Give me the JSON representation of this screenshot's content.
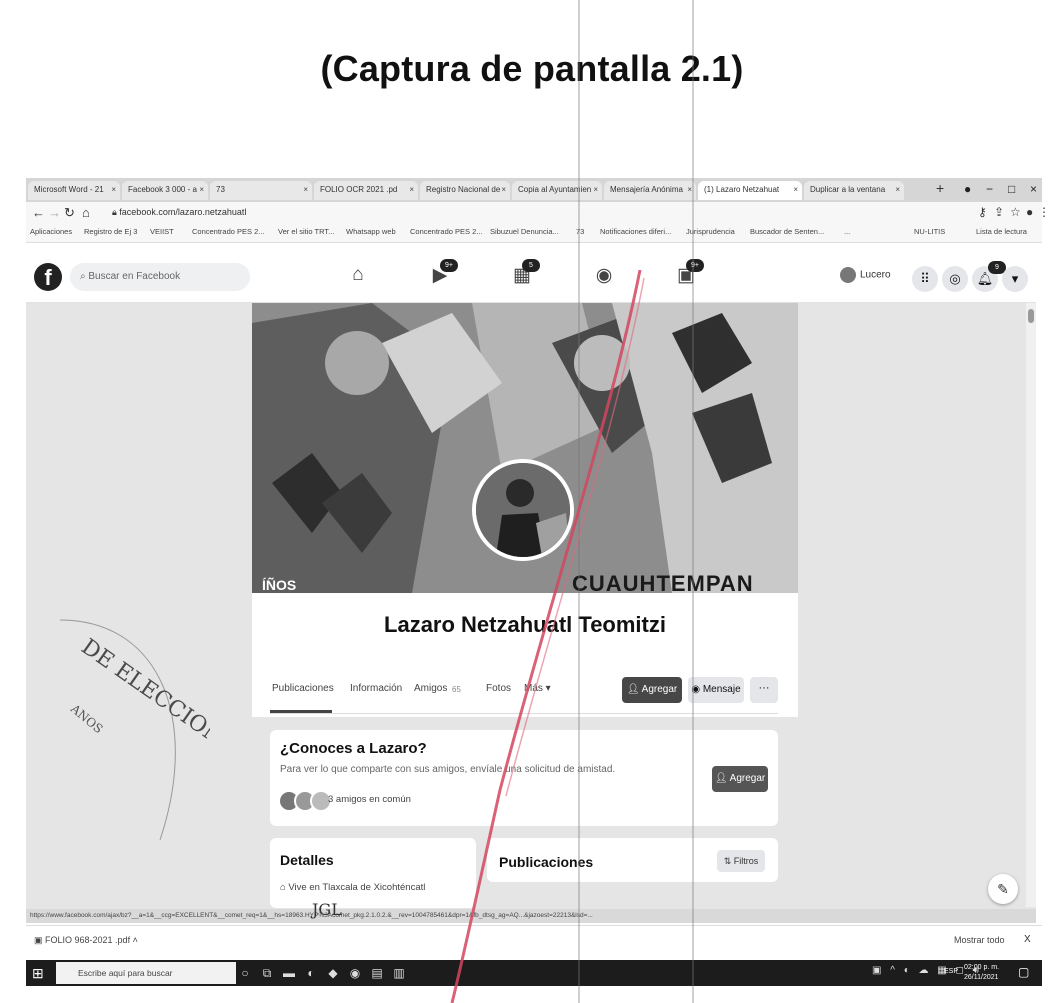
{
  "caption": "(Captura de pantalla 2.1)",
  "browser": {
    "tabs": [
      {
        "label": "Microsoft Word - 21"
      },
      {
        "label": "Facebook 3 000 - a"
      },
      {
        "label": "73"
      },
      {
        "label": "FOLIO OCR 2021 .pd"
      },
      {
        "label": "Registro Nacional de"
      },
      {
        "label": "Copia al Ayuntamien"
      },
      {
        "label": "Mensajería Anónima"
      },
      {
        "label": "(1) Lazaro Netzahuat"
      },
      {
        "label": "Duplicar a la ventana"
      }
    ],
    "new_tab": "+",
    "url": "facebook.com/lazaro.netzahuatl",
    "bookmarks": [
      "Aplicaciones",
      "Registro de Ej 3",
      "VEIIST",
      "Concentrado PES 2...",
      "Ver el sitio TRT...",
      "Whatsapp web",
      "Concentrado PES 2...",
      "Sibuzuel Denuncia...",
      "73",
      "Notificaciones diferi...",
      "Jurisprudencia",
      "Buscador de Senten...",
      "...",
      "NU-LITIS",
      "Lista de lectura"
    ]
  },
  "facebook": {
    "logo": "f",
    "search_placeholder": "Buscar en Facebook",
    "nav_badges": {
      "watch": "9+",
      "marketplace": "5",
      "gaming": "9+"
    },
    "profile_chip": "Lucero",
    "notif_badge": "9",
    "cover_text": "CUAUHTEMPAN",
    "cover_text_left": "ÍÑOS",
    "profile_name": "Lazaro Netzahuatl Teomitzi",
    "profile_tabs": [
      "Publicaciones",
      "Información",
      "Amigos",
      "Fotos",
      "Más ▾"
    ],
    "tab_badge": "65",
    "btn_add": "Agregar",
    "btn_message": "Mensaje",
    "btn_more": "···",
    "know_title": "¿Conoces a Lazaro?",
    "know_desc": "Para ver lo que comparte con sus amigos, envíale una solicitud de amistad.",
    "know_btn": "Agregar",
    "mutual": "3 amigos en común",
    "details_title": "Detalles",
    "details_line": "Vive en Tlaxcala de Xicohténcatl",
    "posts_title": "Publicaciones",
    "posts_filter": "Filtros"
  },
  "status_url": "https://www.facebook.com/ajax/bz?__a=1&__ccg=EXCELLENT&__comet_req=1&__hs=18963.HYP%3Acomet_pkg.2.1.0.2.&__rev=1004785461&dpr=1&fb_dtsg_ag=AQ...&jazoest=22213&lsd=...",
  "download": {
    "file": "FOLIO 968-2021 .pdf",
    "show_all": "Mostrar todo",
    "close": "X"
  },
  "taskbar": {
    "search_placeholder": "Escribe aquí para buscar",
    "lang": "ESP",
    "time": "02:00 p. m.",
    "date": "26/11/2021"
  },
  "scan": {
    "stamp_text": "DE ELECCIONES",
    "stamp_small": "ANOS",
    "signature": "JGL"
  }
}
